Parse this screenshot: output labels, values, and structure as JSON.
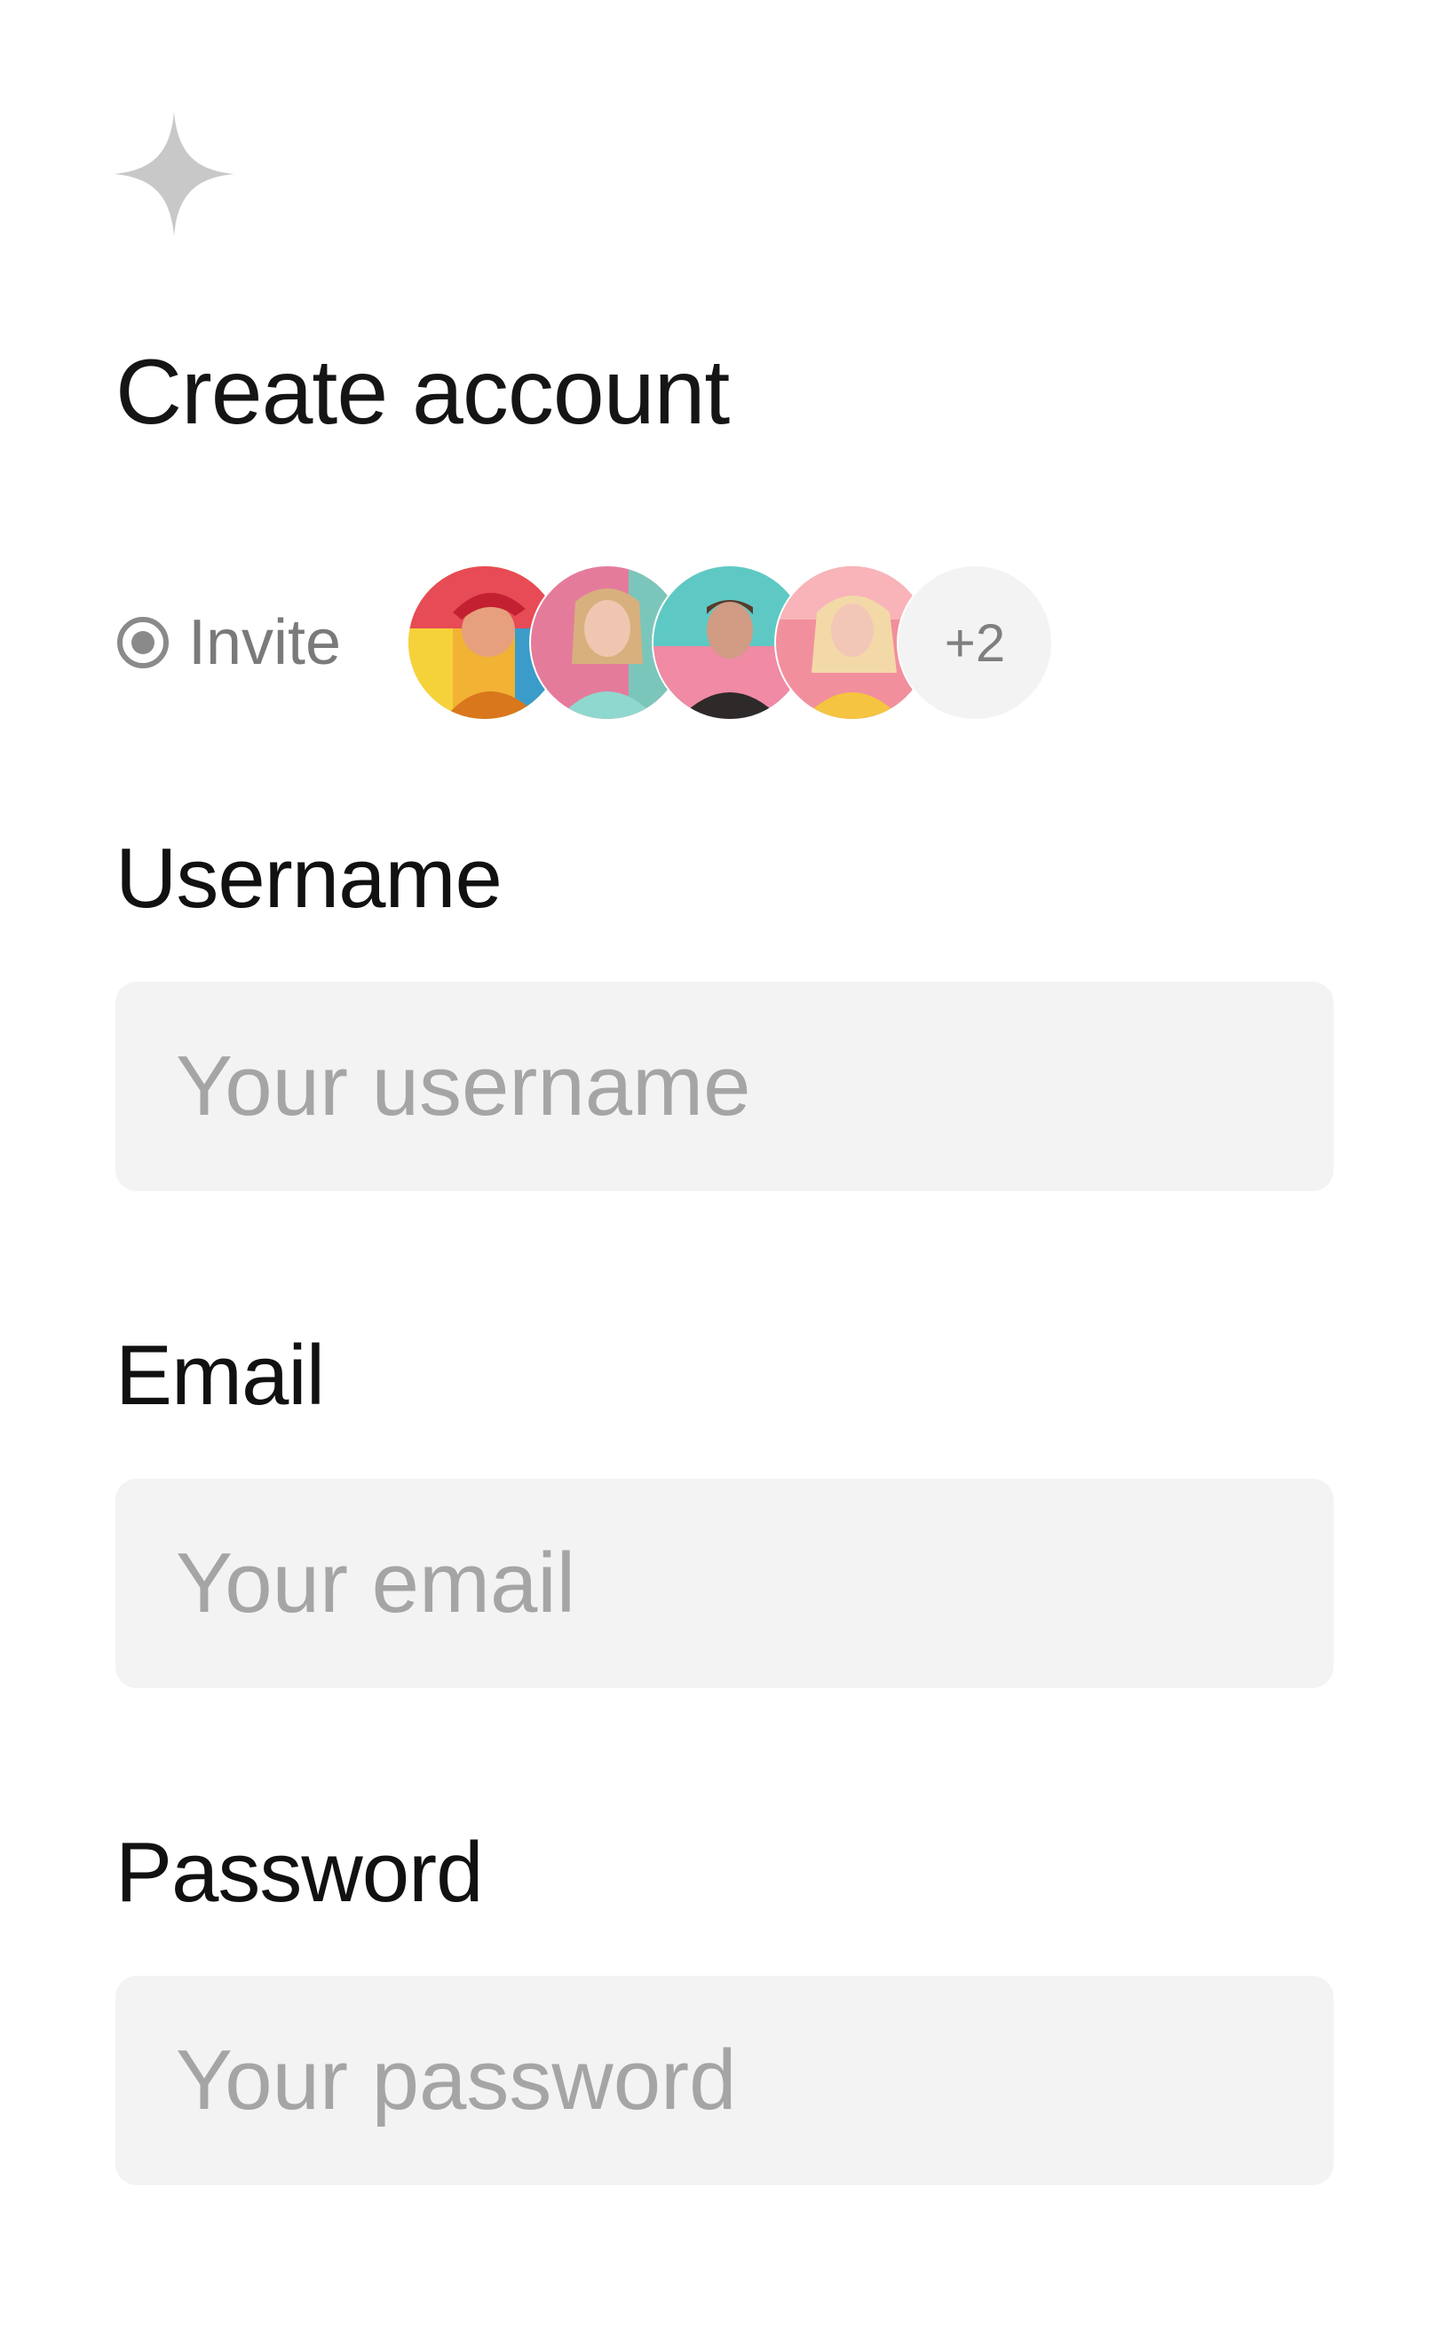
{
  "header": {
    "logo_icon": "sparkle-icon",
    "title": "Create account"
  },
  "invite": {
    "label": "Invite",
    "icon": "radio-icon",
    "avatars": [
      {
        "name": "avatar-1"
      },
      {
        "name": "avatar-2"
      },
      {
        "name": "avatar-3"
      },
      {
        "name": "avatar-4"
      }
    ],
    "more_count": "+2"
  },
  "form": {
    "username": {
      "label": "Username",
      "placeholder": "Your username",
      "value": ""
    },
    "email": {
      "label": "Email",
      "placeholder": "Your email",
      "value": ""
    },
    "password": {
      "label": "Password",
      "placeholder": "Your password",
      "value": ""
    }
  },
  "colors": {
    "background": "#ffffff",
    "input_background": "#f3f3f3",
    "placeholder": "#a5a5a5",
    "muted_text": "#7a7a7a",
    "logo": "#c8c8c8"
  }
}
